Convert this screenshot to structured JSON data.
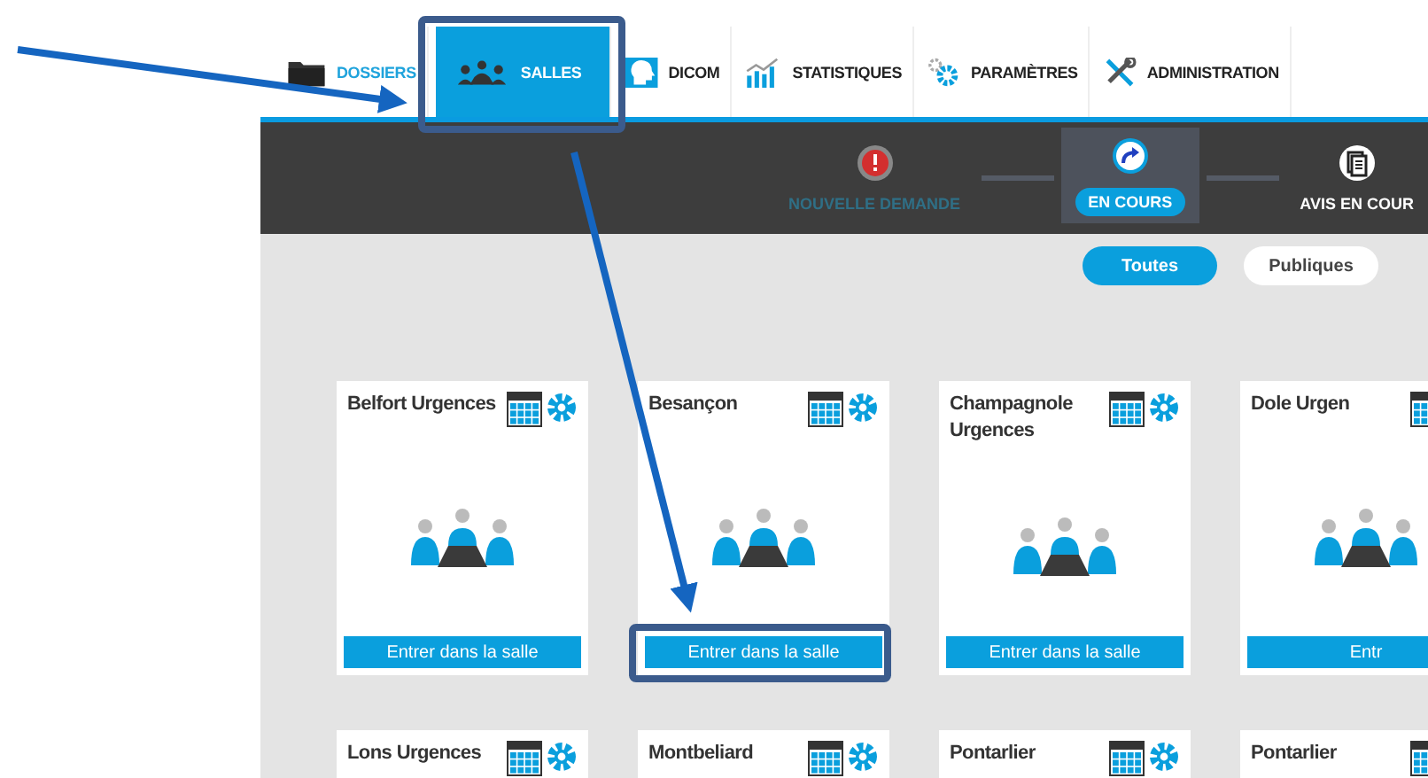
{
  "nav": {
    "tabs": [
      {
        "label": "DOSSIERS",
        "kind": "folder",
        "selected": false,
        "hover": true
      },
      {
        "label": "SALLES",
        "kind": "people",
        "selected": true,
        "hover": false
      },
      {
        "label": "DICOM",
        "kind": "head",
        "selected": false,
        "hover": false
      },
      {
        "label": "STATISTIQUES",
        "kind": "chart",
        "selected": false,
        "hover": false
      },
      {
        "label": "PARAMÈTRES",
        "kind": "gears",
        "selected": false,
        "hover": false
      },
      {
        "label": "ADMINISTRATION",
        "kind": "tools",
        "selected": false,
        "hover": false
      }
    ]
  },
  "stepper": {
    "steps": [
      {
        "label": "NOUVELLE DEMANDE",
        "kind": "alert",
        "selected": false,
        "dimmed": true
      },
      {
        "label": "EN COURS",
        "kind": "forward",
        "selected": true,
        "dimmed": false
      },
      {
        "label": "AVIS EN COUR",
        "kind": "documents",
        "selected": false,
        "dimmed": false
      }
    ]
  },
  "filters": [
    {
      "label": "Toutes",
      "selected": true
    },
    {
      "label": "Publiques",
      "selected": false
    }
  ],
  "rooms": [
    {
      "name": "Belfort Urgences",
      "button": "Entrer dans la salle"
    },
    {
      "name": "Besançon",
      "button": "Entrer dans la salle"
    },
    {
      "name": "Champagnole Urgences",
      "button": "Entrer dans la salle"
    },
    {
      "name": "Dole Urgen",
      "button": "Entr"
    },
    {
      "name": "Lons Urgences"
    },
    {
      "name": "Montbeliard"
    },
    {
      "name": "Pontarlier"
    },
    {
      "name": "Pontarlier"
    }
  ]
}
